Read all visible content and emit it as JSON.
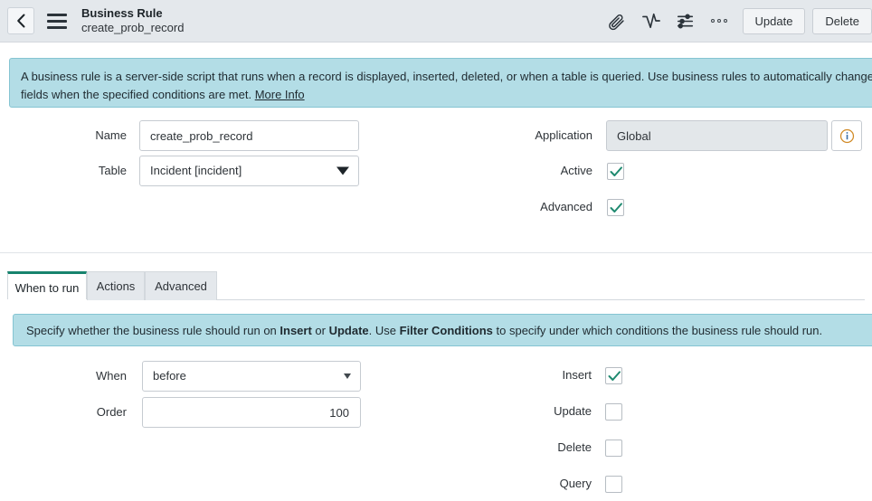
{
  "header": {
    "back_icon": "chevron-left-icon",
    "menu_icon": "hamburger-menu-icon",
    "title": "Business Rule",
    "subtitle": "create_prob_record",
    "icons": [
      {
        "name": "attachment-icon",
        "glyph": "paperclip"
      },
      {
        "name": "activity-icon",
        "glyph": "pulse"
      },
      {
        "name": "personalize-form-icon",
        "glyph": "sliders"
      },
      {
        "name": "more-actions-icon",
        "glyph": "three-dots"
      }
    ],
    "buttons": [
      {
        "label": "Update"
      },
      {
        "label": "Delete"
      }
    ]
  },
  "info_banner": {
    "text_1": "A business rule is a server-side script that runs when a record is displayed, inserted, deleted, or when a table is queried. Use business rules to automatically change values in form fields when the specified conditions are met. ",
    "link": "More Info"
  },
  "form": {
    "name": {
      "label": "Name",
      "value": "create_prob_record"
    },
    "table": {
      "label": "Table",
      "value": "Incident [incident]"
    },
    "application": {
      "label": "Application",
      "value": "Global",
      "readonly": true,
      "info_icon": "info-circle-icon"
    },
    "active": {
      "label": "Active",
      "checked": true
    },
    "advanced": {
      "label": "Advanced",
      "checked": true
    }
  },
  "tabs": {
    "items": [
      {
        "label": "When to run",
        "active": true
      },
      {
        "label": "Actions",
        "active": false
      },
      {
        "label": "Advanced",
        "active": false
      }
    ]
  },
  "tab_banner": {
    "prefix": "Specify whether the business rule should run on ",
    "bold_1": "Insert",
    "mid_1": " or ",
    "bold_2": "Update",
    "mid_2": ". Use ",
    "bold_3": "Filter Conditions",
    "suffix": " to specify under which conditions the business rule should run."
  },
  "when_to_run": {
    "when": {
      "label": "When",
      "value": "before"
    },
    "order": {
      "label": "Order",
      "value": "100"
    },
    "insert": {
      "label": "Insert",
      "checked": true
    },
    "update": {
      "label": "Update",
      "checked": false
    },
    "delete": {
      "label": "Delete",
      "checked": false
    },
    "query": {
      "label": "Query",
      "checked": false
    }
  },
  "colors": {
    "accent_green": "#16836d",
    "banner_bg": "#b3dde6",
    "header_bg": "#e4e8ec",
    "check_green": "#1f8a70"
  }
}
